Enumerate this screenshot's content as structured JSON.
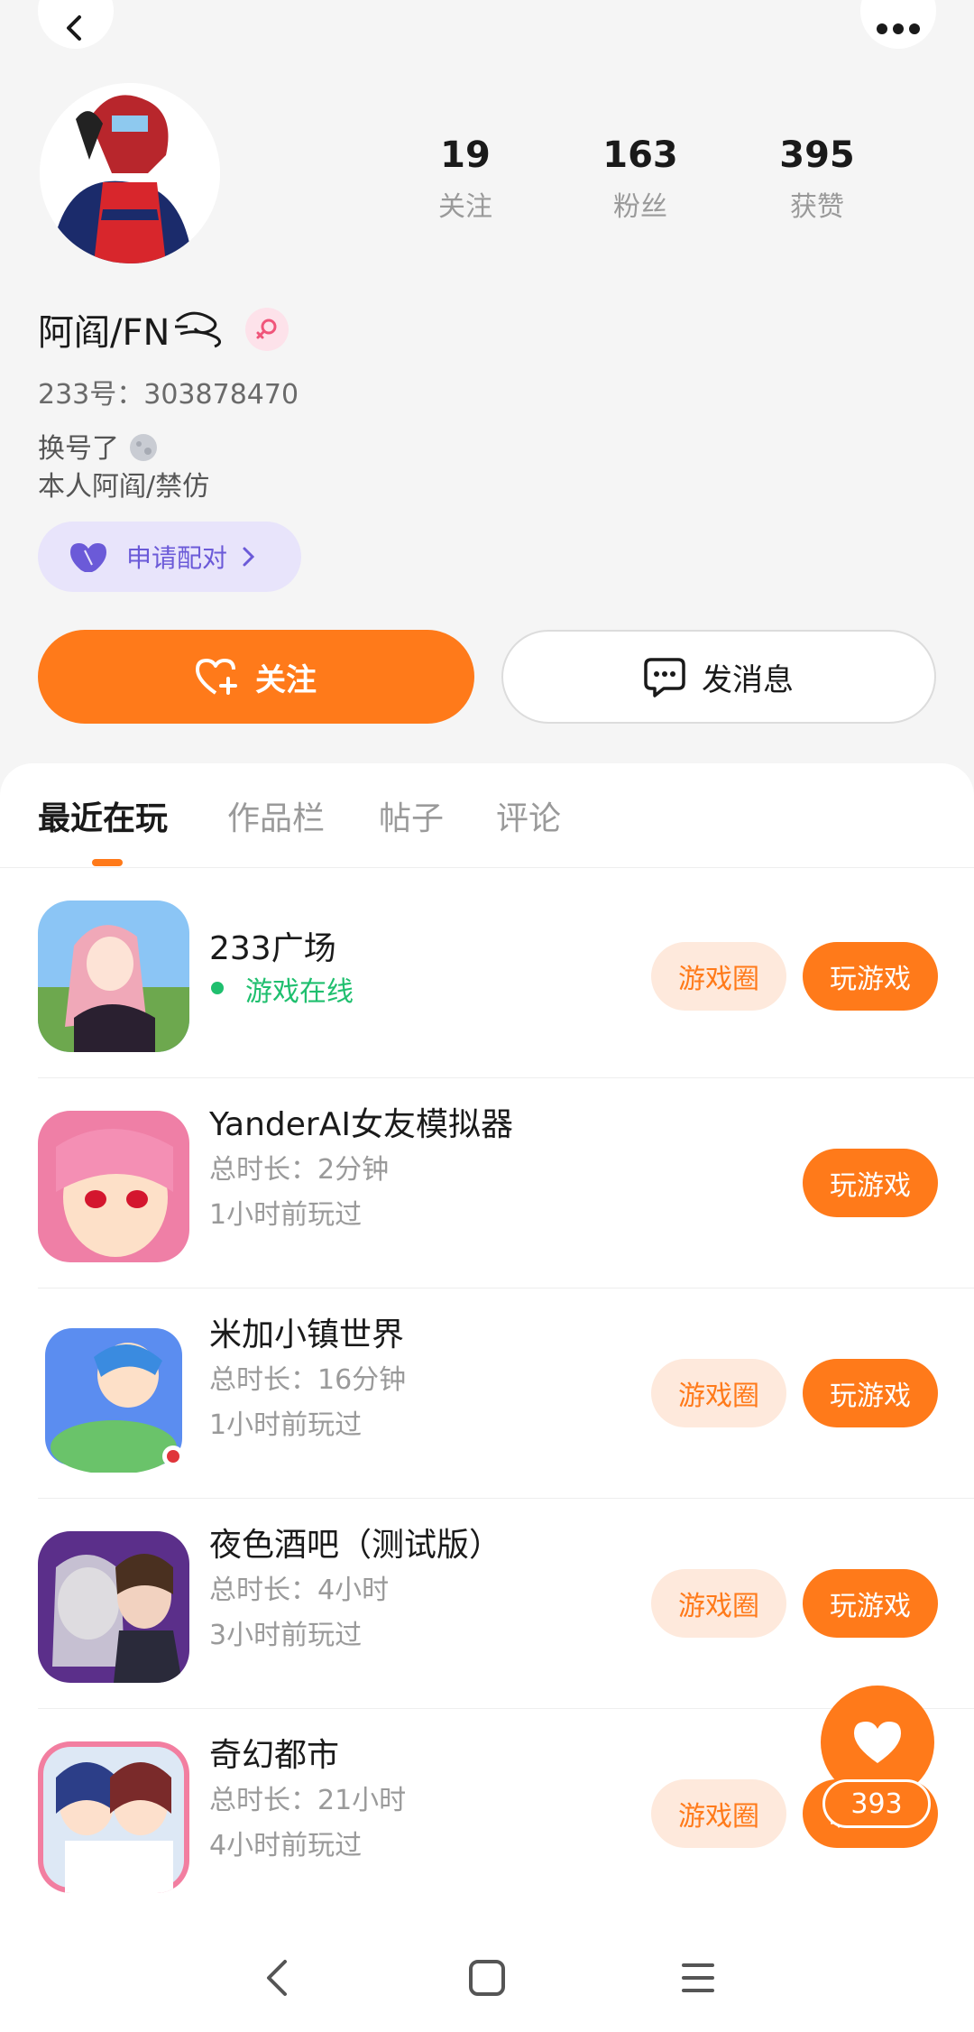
{
  "profile": {
    "name": "阿阎/FN",
    "uid": "233号：303878470",
    "bio_line1": "换号了",
    "bio_line2": "本人阿阎/禁仿",
    "stats": [
      {
        "num": "19",
        "label": "关注"
      },
      {
        "num": "163",
        "label": "粉丝"
      },
      {
        "num": "395",
        "label": "获赞"
      }
    ]
  },
  "actions": {
    "pair_label": "申请配对",
    "follow_label": "关注",
    "message_label": "发消息"
  },
  "tabs": [
    "最近在玩",
    "作品栏",
    "帖子",
    "评论"
  ],
  "games": [
    {
      "title": "233广场",
      "sub1": "游戏在线",
      "sub2": "",
      "circle": "游戏圈",
      "play": "玩游戏"
    },
    {
      "title": "YanderAI女友模拟器",
      "sub1": "总时长：2分钟",
      "sub2": "1小时前玩过",
      "circle": "",
      "play": "玩游戏"
    },
    {
      "title": "米加小镇世界",
      "sub1": "总时长：16分钟",
      "sub2": "1小时前玩过",
      "circle": "游戏圈",
      "play": "玩游戏"
    },
    {
      "title": "夜色酒吧（测试版）",
      "sub1": "总时长：4小时",
      "sub2": "3小时前玩过",
      "circle": "游戏圈",
      "play": "玩游戏"
    },
    {
      "title": "奇幻都市",
      "sub1": "总时长：21小时",
      "sub2": "4小时前玩过",
      "circle": "游戏圈",
      "play": "玩游戏"
    }
  ],
  "fab": {
    "count": "393"
  },
  "colors": {
    "accent": "#ff7a1a",
    "online": "#1fbf6e",
    "pair": "#6b5ad8"
  }
}
